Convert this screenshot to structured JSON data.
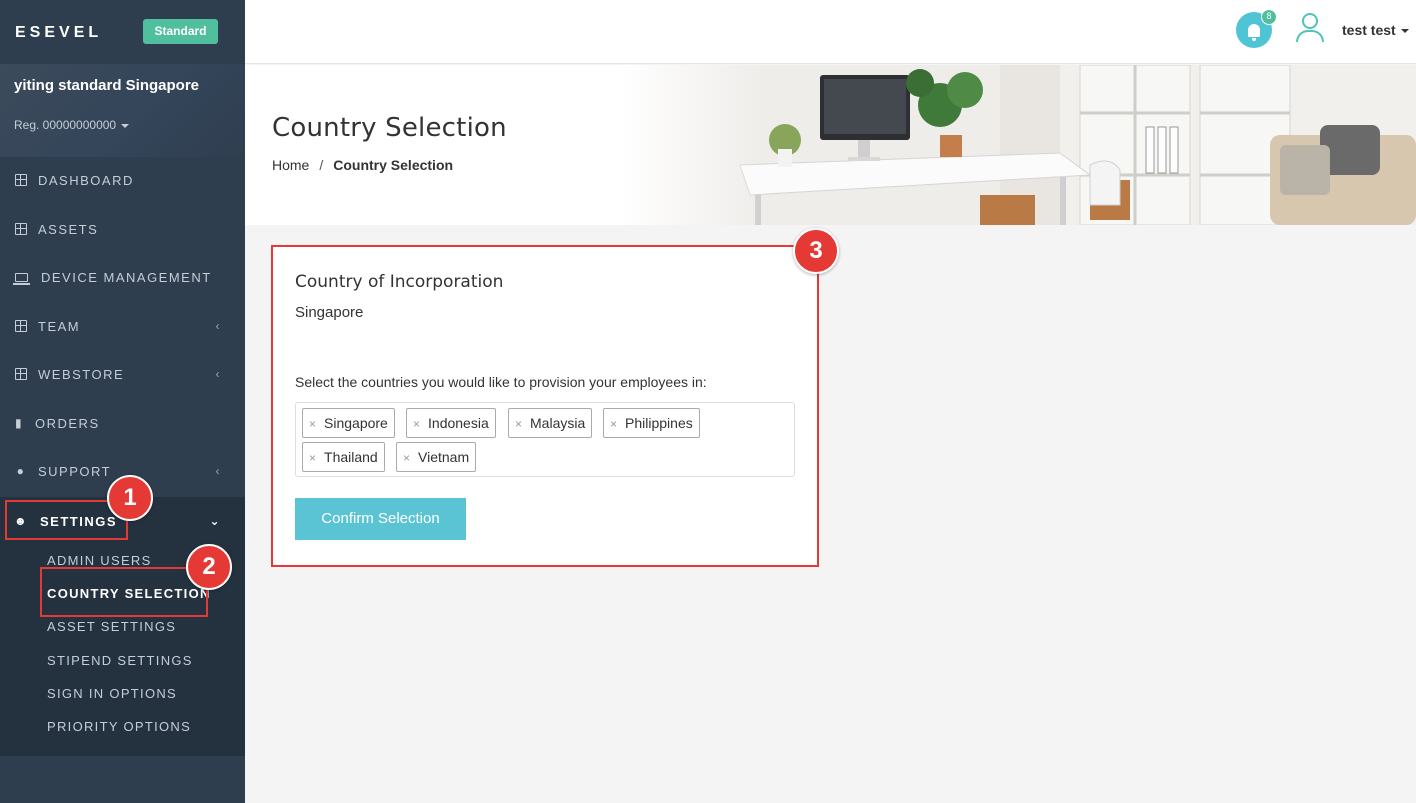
{
  "brand": {
    "logo": "ESEVEL",
    "plan": "Standard"
  },
  "company": {
    "name": "yiting standard Singapore",
    "reg": "Reg. 00000000000"
  },
  "nav": {
    "dashboard": "DASHBOARD",
    "assets": "ASSETS",
    "device_management": "DEVICE MANAGEMENT",
    "team": "TEAM",
    "webstore": "WEBSTORE",
    "orders": "ORDERS",
    "support": "SUPPORT",
    "settings": "SETTINGS",
    "settings_sub": [
      "ADMIN USERS",
      "COUNTRY SELECTION",
      "ASSET SETTINGS",
      "STIPEND SETTINGS",
      "SIGN IN OPTIONS",
      "PRIORITY OPTIONS"
    ]
  },
  "topbar": {
    "notification_count": "8",
    "user_name": "test test"
  },
  "page": {
    "title": "Country Selection",
    "breadcrumb_home": "Home",
    "breadcrumb_sep": "/",
    "breadcrumb_current": "Country Selection"
  },
  "card": {
    "title": "Country of Incorporation",
    "country": "Singapore",
    "label": "Select the countries you would like to provision your employees in:",
    "tag_remove": "×",
    "tags": [
      "Singapore",
      "Indonesia",
      "Malaysia",
      "Philippines",
      "Thailand",
      "Vietnam"
    ],
    "confirm": "Confirm Selection"
  },
  "annotations": {
    "step1": "1",
    "step2": "2",
    "step3": "3"
  },
  "colors": {
    "sidebar": "#2e3e4e",
    "accent": "#5bc4d4",
    "badge": "#4fbf9e",
    "highlight": "#e53935"
  }
}
